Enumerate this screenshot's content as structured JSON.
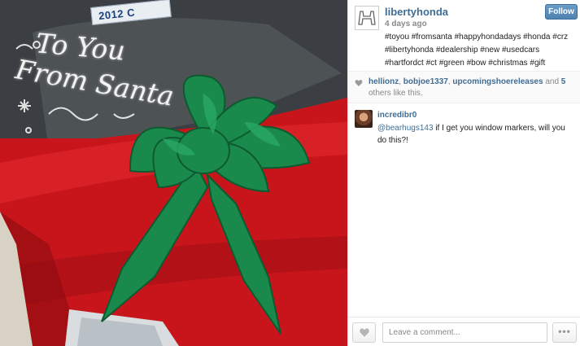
{
  "photo": {
    "plate_text": "2012 C",
    "window_text_line1": "To You",
    "window_text_line2": "From Santa"
  },
  "post": {
    "username": "libertyhonda",
    "timestamp": "4 days ago",
    "follow_label": "Follow",
    "caption": "#toyou #fromsanta #happyhondadays #honda #crz #libertyhonda #dealership #new #usedcars #hartfordct #ct #green #bow #christmas #gift"
  },
  "likes": {
    "users": [
      "hellionz",
      "bobjoe1337",
      "upcomingshoereleases"
    ],
    "sep1": ", ",
    "sep2": ", ",
    "and_text": " and ",
    "others_count": "5",
    "others_text": " others like this."
  },
  "comments": [
    {
      "user": "incredibr0",
      "mention": "@bearhugs143",
      "text": " if I get you window markers, will you do this?!"
    }
  ],
  "footer": {
    "comment_placeholder": "Leave a comment...",
    "more_label": "•••"
  },
  "colors": {
    "link_blue": "#3f6d94",
    "follow_button": "#5b8dbb",
    "bow_green": "#1a8a4c",
    "car_red": "#c8151b"
  }
}
